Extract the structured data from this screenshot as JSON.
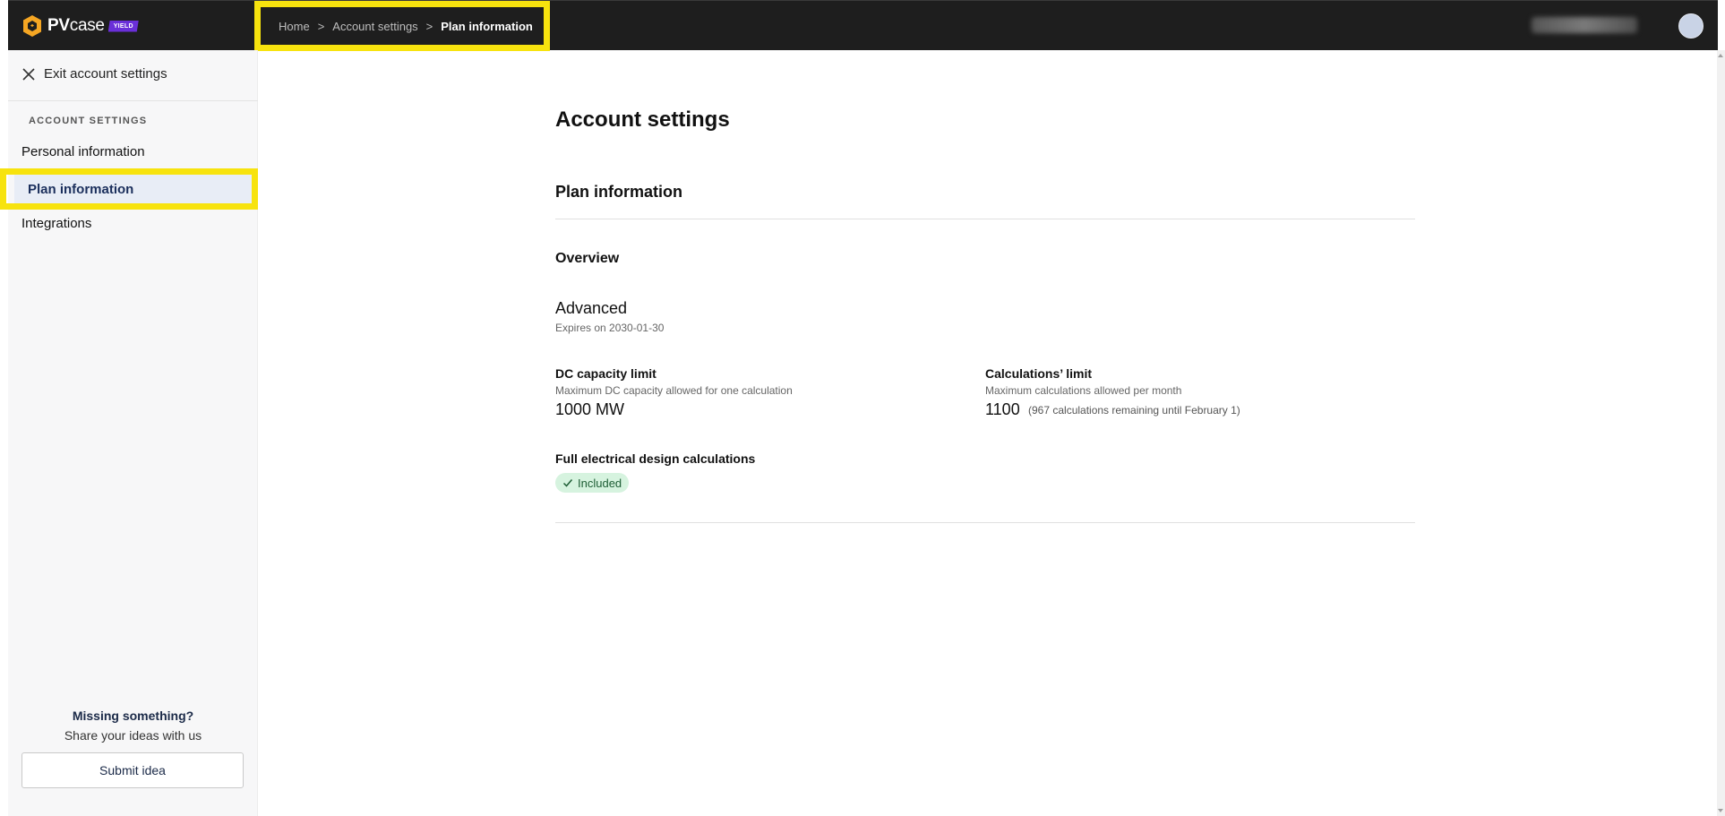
{
  "header": {
    "logo": {
      "text_pv": "PV",
      "text_case": "case",
      "badge": "YIELD"
    },
    "breadcrumb": {
      "items": [
        "Home",
        "Account settings"
      ],
      "separator": ">",
      "current": "Plan information"
    },
    "avatar_icon": "user-avatar"
  },
  "sidebar": {
    "exit_label": "Exit account settings",
    "section_label": "ACCOUNT SETTINGS",
    "items": [
      {
        "label": "Personal information"
      },
      {
        "label": "Plan information",
        "active": true
      },
      {
        "label": "Integrations"
      }
    ],
    "missing_title": "Missing something?",
    "missing_subtitle": "Share your ideas with us",
    "submit_label": "Submit idea"
  },
  "main": {
    "page_title": "Account settings",
    "section_title": "Plan information",
    "overview_label": "Overview",
    "plan_name": "Advanced",
    "plan_expiry": "Expires on 2030-01-30",
    "dc_capacity": {
      "title": "DC capacity limit",
      "description": "Maximum DC capacity allowed for one calculation",
      "value": "1000 MW"
    },
    "calculations": {
      "title": "Calculations’ limit",
      "description": "Maximum calculations allowed per month",
      "value": "1100",
      "note": "(967 calculations remaining until February 1)"
    },
    "electrical": {
      "title": "Full electrical design calculations",
      "badge": "Included"
    }
  },
  "colors": {
    "topbar": "#1e1e1e",
    "highlight": "#f7e30e",
    "brand_purple": "#6a2fd8",
    "logo_orange": "#f5a623",
    "active_item_bg": "#e8edf6",
    "included_bg": "#d6f3df"
  }
}
